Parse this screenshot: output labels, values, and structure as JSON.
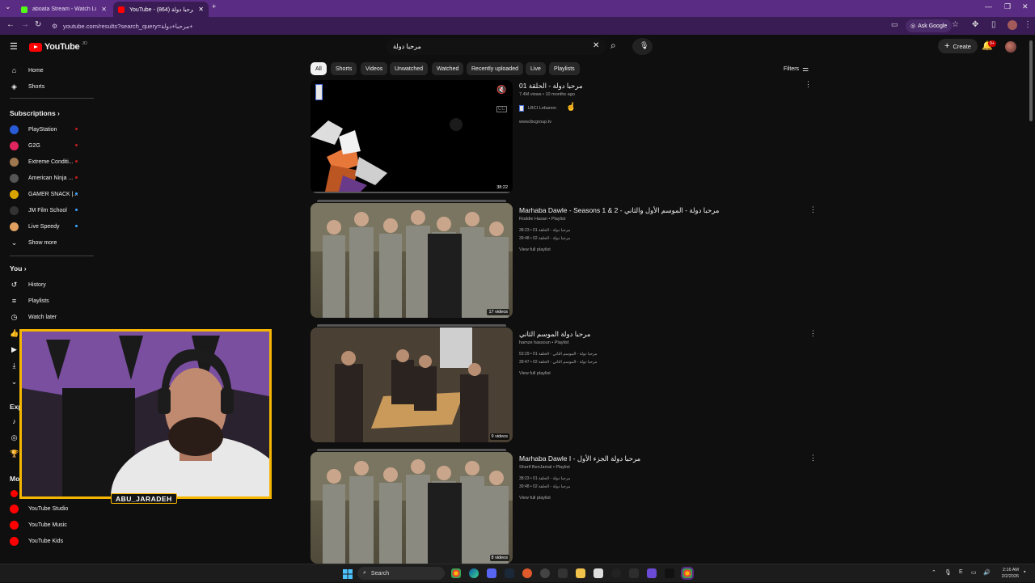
{
  "browser": {
    "tabs": [
      {
        "title": "aboata Stream - Watch Live on",
        "fav_color": "#53fc18"
      },
      {
        "title": "YouTube - مرحبا دولة (864)",
        "fav_color": "#ff0000"
      }
    ],
    "new_tab": "+",
    "url": "youtube.com/results?search_query=مرحبا+دولة+",
    "ask_google": "Ask Google"
  },
  "yt_header": {
    "logo_word": "YouTube",
    "logo_country": "JO",
    "search_value": "مرحبا دولة",
    "create_label": "Create",
    "notif_count": "9+"
  },
  "sidebar": {
    "main": [
      {
        "label": "Home",
        "icon": "home-icon",
        "glyph": "⌂"
      },
      {
        "label": "Shorts",
        "icon": "shorts-icon",
        "glyph": "◈"
      }
    ],
    "subs_heading": "Subscriptions",
    "subs": [
      {
        "label": "PlayStation",
        "color": "#2a5bd7",
        "live": true
      },
      {
        "label": "G2G",
        "color": "#e0245e",
        "live": true
      },
      {
        "label": "Extreme Conditi...",
        "color": "#a07850",
        "live": true
      },
      {
        "label": "American Ninja ...",
        "color": "#555555",
        "live": true
      },
      {
        "label": "GAMER SNACK |...",
        "color": "#d9a400",
        "live": false
      },
      {
        "label": "JM Film School",
        "color": "#333333",
        "live": false
      },
      {
        "label": "Live Speedy",
        "color": "#e0a060",
        "live": false
      }
    ],
    "show_more": "Show more",
    "you_heading": "You",
    "you_items": [
      {
        "label": "History",
        "icon": "history-icon",
        "glyph": "↺"
      },
      {
        "label": "Playlists",
        "icon": "playlists-icon",
        "glyph": "≡"
      },
      {
        "label": "Watch later",
        "icon": "watch-later-icon",
        "glyph": "◷"
      }
    ],
    "explore_heading": "Exp",
    "more_heading": "Mo",
    "more_items": [
      {
        "label": "YouTube Studio"
      },
      {
        "label": "YouTube Music"
      },
      {
        "label": "YouTube Kids"
      }
    ]
  },
  "chips": [
    "All",
    "Shorts",
    "Videos",
    "Unwatched",
    "Watched",
    "Recently uploaded",
    "Live",
    "Playlists"
  ],
  "filters_label": "Filters",
  "results": [
    {
      "title": "مرحبا دولة - الحلقة 01",
      "meta": "7.4M views • 10 months ago",
      "channel": "LBCI Lebanon",
      "link": "www.lbcgroup.tv",
      "badge": "38:22"
    },
    {
      "title": "Marhaba Dawle - Seasons 1 & 2 - مرحبا دولة - الموسم الأول والثاني",
      "meta": "Roddie Hasan • Playlist",
      "episodes": [
        "38:23 • مرحبا دولة - الحلقة 01",
        "39:48 • مرحبا دولة - الحلقة 02"
      ],
      "view_full": "View full playlist",
      "badge": "17 videos"
    },
    {
      "title": "مرحبا دولة الموسم الثاني",
      "meta": "hamze hassoun • Playlist",
      "episodes": [
        "53:29 • مرحبا دولة - الموسم الثاني - الحلقة 01",
        "39:47 • مرحبا دولة - الموسم الثاني - الحلقة 02"
      ],
      "view_full": "View full playlist",
      "badge": "9 videos"
    },
    {
      "title": "Marhaba Dawle I - مرحبا دولة الجزء الأول",
      "meta": "Sherif BenJamal • Playlist",
      "episodes": [
        "38:23 • مرحبا دولة - الحلقة 01",
        "39:48 • مرحبا دولة - الحلقة 02"
      ],
      "view_full": "View full playlist",
      "badge": "8 videos"
    }
  ],
  "webcam": {
    "name": "ABU_JARADEH"
  },
  "taskbar": {
    "search_label": "Search",
    "time": "2:16 AM",
    "date": "2/2/2026"
  }
}
